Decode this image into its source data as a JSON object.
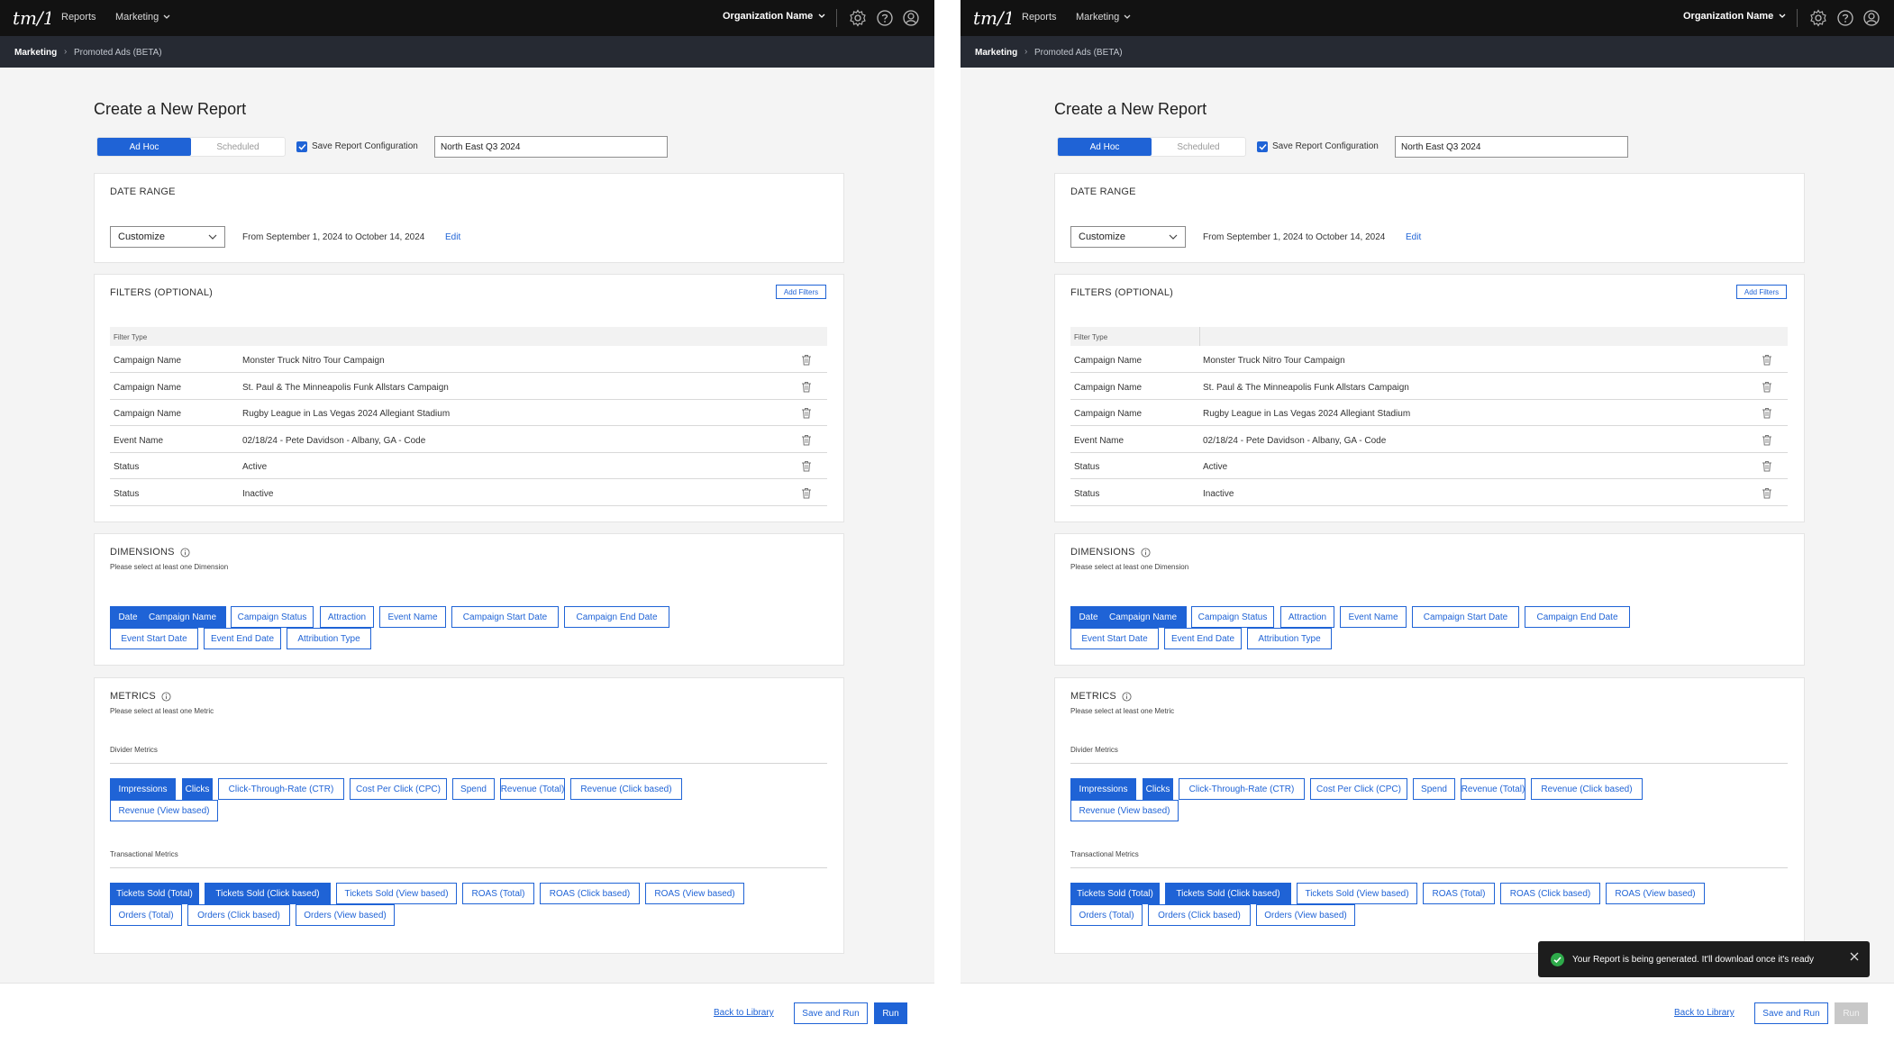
{
  "app": {
    "logo": "tm/1",
    "nav_reports": "Reports",
    "nav_marketing": "Marketing",
    "org_name": "Organization Name"
  },
  "breadcrumb": {
    "section": "Marketing",
    "separator": "›",
    "page": "Promoted Ads (BETA)"
  },
  "page": {
    "title": "Create a New Report",
    "tab_adhoc": "Ad Hoc",
    "tab_scheduled": "Scheduled",
    "save_config_label": "Save Report Configuration",
    "report_name_value": "North East Q3 2024"
  },
  "date_range": {
    "title": "DATE RANGE",
    "selected": "Customize",
    "range_text": "From September 1, 2024 to October 14, 2024",
    "edit_label": "Edit"
  },
  "filters": {
    "title": "FILTERS (OPTIONAL)",
    "add_label": "Add Filters",
    "header": "Filter Type",
    "rows": [
      {
        "type": "Campaign Name",
        "value": "Monster Truck Nitro Tour Campaign"
      },
      {
        "type": "Campaign Name",
        "value": "St. Paul & The Minneapolis Funk Allstars Campaign"
      },
      {
        "type": "Campaign Name",
        "value": "Rugby League in Las Vegas 2024 Allegiant Stadium"
      },
      {
        "type": "Event Name",
        "value": "02/18/24 - Pete Davidson - Albany, GA - Code"
      },
      {
        "type": "Status",
        "value": "Active"
      },
      {
        "type": "Status",
        "value": "Inactive"
      }
    ]
  },
  "dimensions": {
    "title": "DIMENSIONS",
    "subtitle": "Please select at least one Dimension",
    "chips": [
      {
        "label": "Date",
        "selected": true
      },
      {
        "label": "Campaign Name",
        "selected": true
      },
      {
        "label": "Campaign Status",
        "selected": false
      },
      {
        "label": "Attraction",
        "selected": false
      },
      {
        "label": "Event Name",
        "selected": false
      },
      {
        "label": "Campaign Start Date",
        "selected": false
      },
      {
        "label": "Campaign End Date",
        "selected": false
      },
      {
        "label": "Event Start Date",
        "selected": false
      },
      {
        "label": "Event End Date",
        "selected": false
      },
      {
        "label": "Attribution Type",
        "selected": false
      }
    ]
  },
  "metrics": {
    "title": "METRICS",
    "subtitle": "Please select at least one Metric",
    "group1": "Divider Metrics",
    "group1_chips": [
      {
        "label": "Impressions",
        "selected": true
      },
      {
        "label": "Clicks",
        "selected": true
      },
      {
        "label": "Click-Through-Rate (CTR)",
        "selected": false
      },
      {
        "label": "Cost Per Click (CPC)",
        "selected": false
      },
      {
        "label": "Spend",
        "selected": false
      },
      {
        "label": "Revenue (Total)",
        "selected": false
      },
      {
        "label": "Revenue (Click based)",
        "selected": false
      },
      {
        "label": "Revenue (View based)",
        "selected": false
      }
    ],
    "group2": "Transactional Metrics",
    "group2_chips": [
      {
        "label": "Tickets Sold (Total)",
        "selected": true
      },
      {
        "label": "Tickets Sold (Click based)",
        "selected": true
      },
      {
        "label": "Tickets Sold (View based)",
        "selected": false
      },
      {
        "label": "ROAS (Total)",
        "selected": false
      },
      {
        "label": "ROAS (Click based)",
        "selected": false
      },
      {
        "label": "ROAS (View based)",
        "selected": false
      },
      {
        "label": "Orders (Total)",
        "selected": false
      },
      {
        "label": "Orders (Click based)",
        "selected": false
      },
      {
        "label": "Orders (View based)",
        "selected": false
      }
    ]
  },
  "footer": {
    "back_label": "Back to Library",
    "save_run_label": "Save and Run",
    "run_label": "Run"
  },
  "toast": {
    "message": "Your Report is being generated. It'll download once it's ready"
  },
  "colors": {
    "accent": "#1f63d6",
    "topbar": "#121212",
    "subbar": "#262a33",
    "toast_bg": "#1d1d1d",
    "success": "#2eaa4a"
  }
}
